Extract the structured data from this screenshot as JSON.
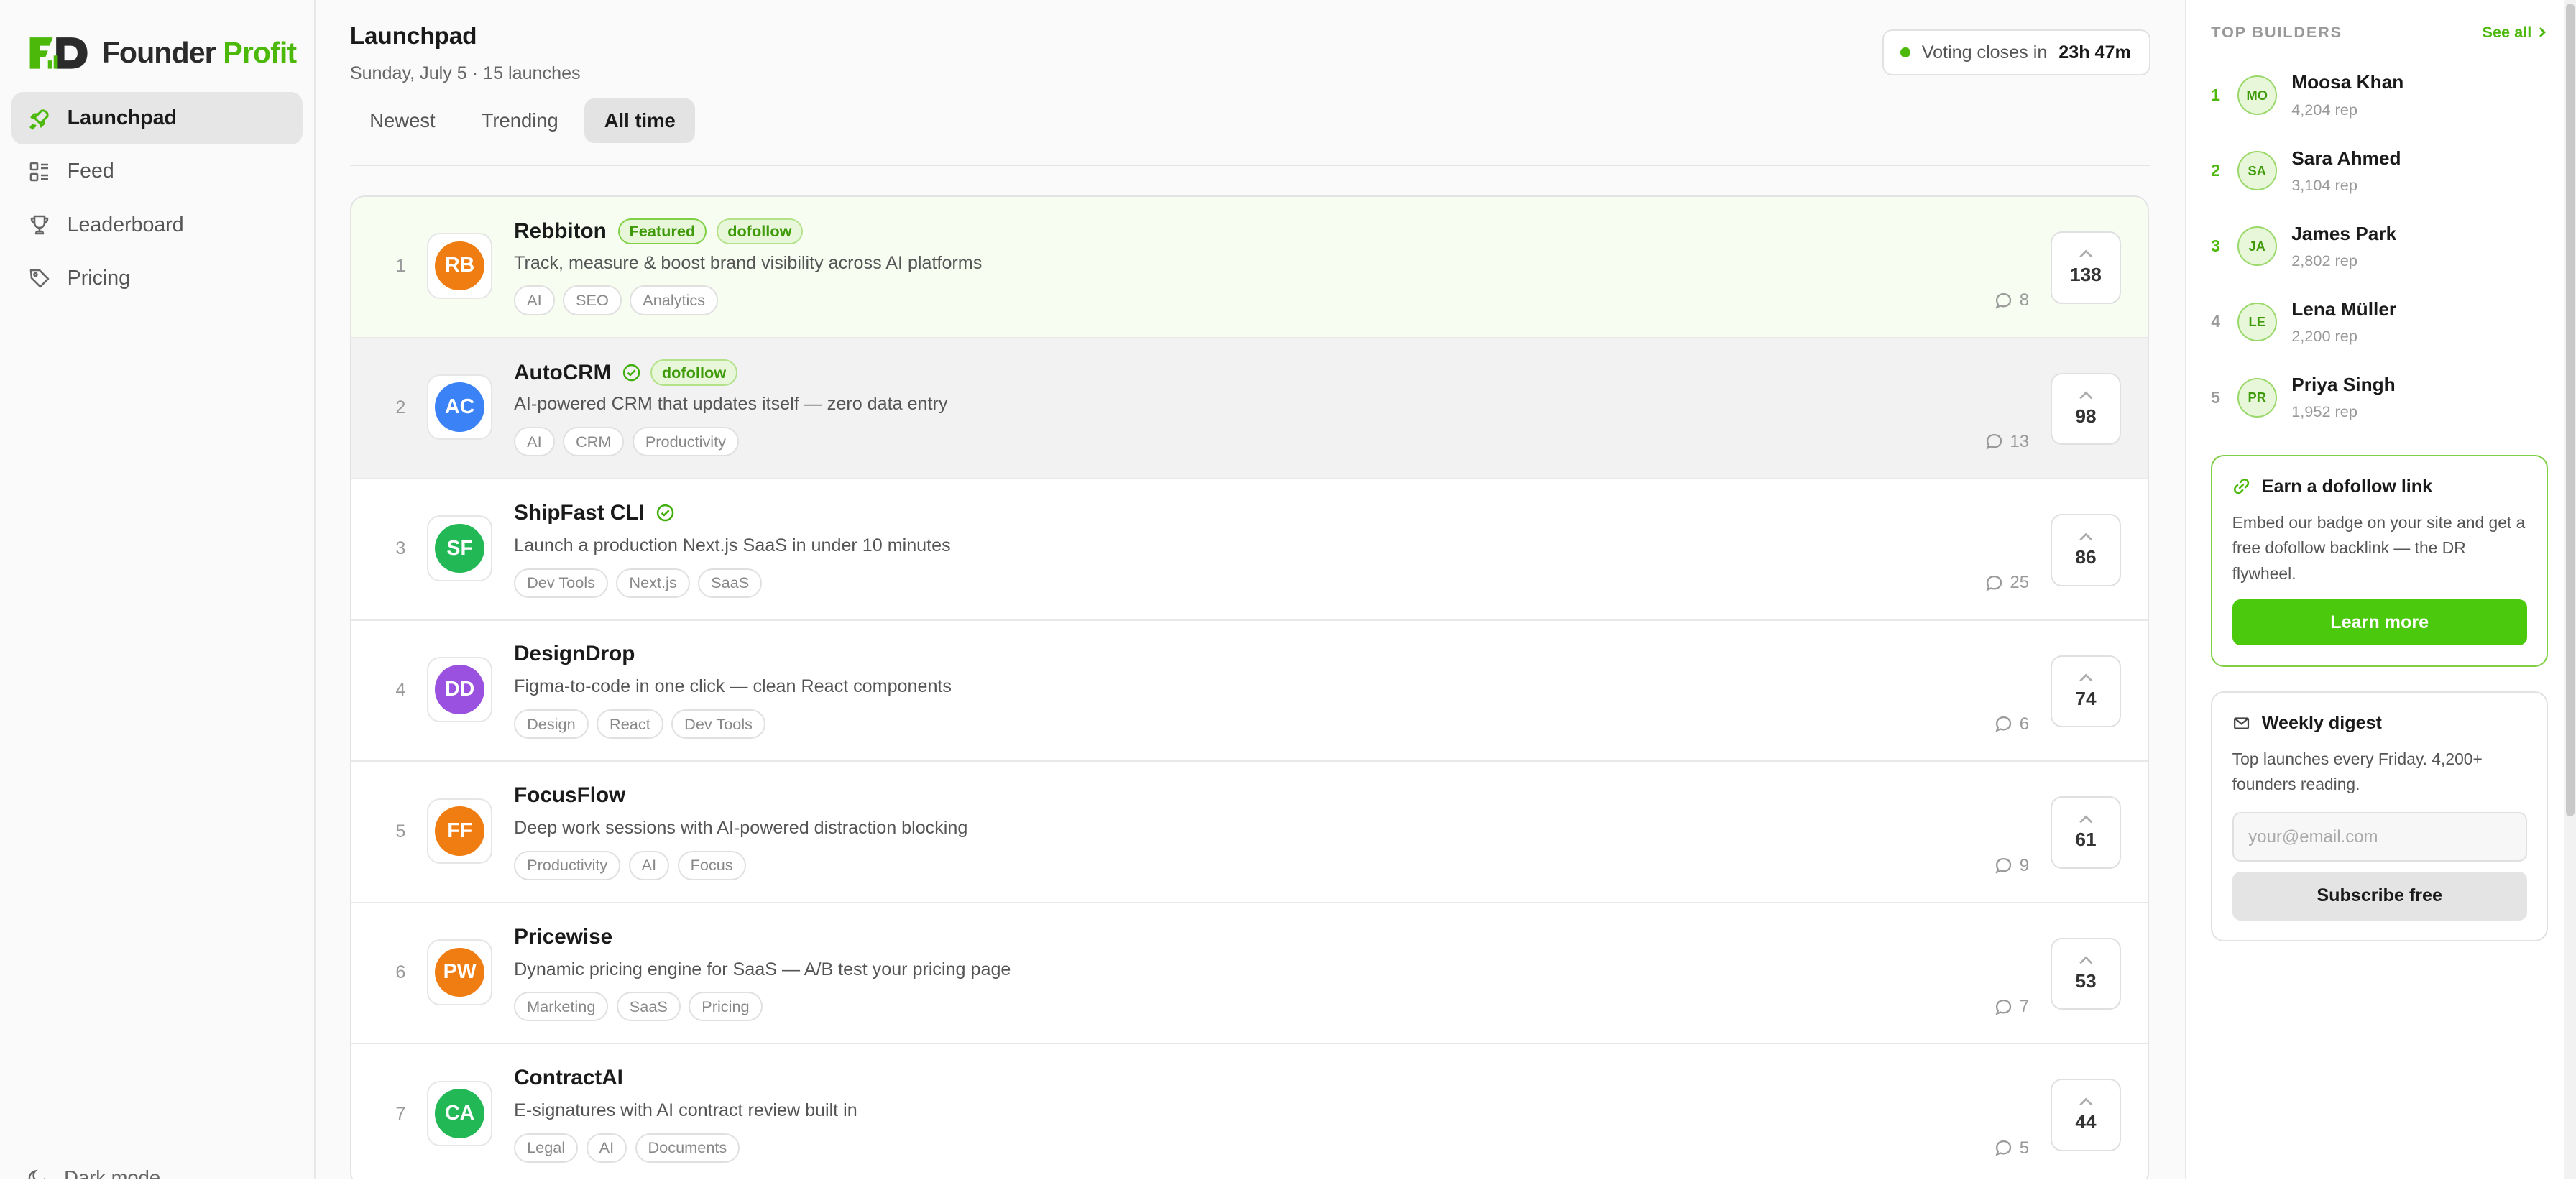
{
  "brand": {
    "name_part1": "Founder",
    "name_part2": "Profit",
    "accent": "#4bb80a"
  },
  "sidebar": {
    "items": [
      {
        "label": "Launchpad",
        "icon": "rocket-icon",
        "active": true
      },
      {
        "label": "Feed",
        "icon": "feed-icon",
        "active": false
      },
      {
        "label": "Leaderboard",
        "icon": "trophy-icon",
        "active": false
      },
      {
        "label": "Pricing",
        "icon": "tag-icon",
        "active": false
      }
    ],
    "bottom_label": "Dark mode"
  },
  "header": {
    "title": "Launchpad",
    "subtitle": "Sunday, July 5 · 15 launches",
    "voting_prefix": "Voting closes in",
    "voting_time": "23h 47m"
  },
  "tabs": [
    {
      "label": "Newest",
      "active": false
    },
    {
      "label": "Trending",
      "active": false
    },
    {
      "label": "All time",
      "active": true
    }
  ],
  "products": [
    {
      "rank": "1",
      "initials": "RB",
      "color": "#f07d12",
      "name": "Rebbiton",
      "verified": false,
      "featured_label": "Featured",
      "dofollow_label": "dofollow",
      "desc": "Track, measure & boost brand visibility across AI platforms",
      "tags": [
        "AI",
        "SEO",
        "Analytics"
      ],
      "comments": "8",
      "votes": "138",
      "state": "featured"
    },
    {
      "rank": "2",
      "initials": "AC",
      "color": "#3b82f6",
      "name": "AutoCRM",
      "verified": true,
      "featured_label": "",
      "dofollow_label": "dofollow",
      "desc": "AI-powered CRM that updates itself — zero data entry",
      "tags": [
        "AI",
        "CRM",
        "Productivity"
      ],
      "comments": "13",
      "votes": "98",
      "state": "hover"
    },
    {
      "rank": "3",
      "initials": "SF",
      "color": "#22b855",
      "name": "ShipFast CLI",
      "verified": true,
      "featured_label": "",
      "dofollow_label": "",
      "desc": "Launch a production Next.js SaaS in under 10 minutes",
      "tags": [
        "Dev Tools",
        "Next.js",
        "SaaS"
      ],
      "comments": "25",
      "votes": "86",
      "state": ""
    },
    {
      "rank": "4",
      "initials": "DD",
      "color": "#9b51e0",
      "name": "DesignDrop",
      "verified": false,
      "featured_label": "",
      "dofollow_label": "",
      "desc": "Figma-to-code in one click — clean React components",
      "tags": [
        "Design",
        "React",
        "Dev Tools"
      ],
      "comments": "6",
      "votes": "74",
      "state": ""
    },
    {
      "rank": "5",
      "initials": "FF",
      "color": "#f07d12",
      "name": "FocusFlow",
      "verified": false,
      "featured_label": "",
      "dofollow_label": "",
      "desc": "Deep work sessions with AI-powered distraction blocking",
      "tags": [
        "Productivity",
        "AI",
        "Focus"
      ],
      "comments": "9",
      "votes": "61",
      "state": ""
    },
    {
      "rank": "6",
      "initials": "PW",
      "color": "#f07d12",
      "name": "Pricewise",
      "verified": false,
      "featured_label": "",
      "dofollow_label": "",
      "desc": "Dynamic pricing engine for SaaS — A/B test your pricing page",
      "tags": [
        "Marketing",
        "SaaS",
        "Pricing"
      ],
      "comments": "7",
      "votes": "53",
      "state": ""
    },
    {
      "rank": "7",
      "initials": "CA",
      "color": "#22b855",
      "name": "ContractAI",
      "verified": false,
      "featured_label": "",
      "dofollow_label": "",
      "desc": "E-signatures with AI contract review built in",
      "tags": [
        "Legal",
        "AI",
        "Documents"
      ],
      "comments": "5",
      "votes": "44",
      "state": ""
    }
  ],
  "right": {
    "builders_title": "TOP BUILDERS",
    "see_all": "See all",
    "builders": [
      {
        "rank": "1",
        "initials": "MO",
        "name": "Moosa Khan",
        "rep": "4,204 rep",
        "top": true
      },
      {
        "rank": "2",
        "initials": "SA",
        "name": "Sara Ahmed",
        "rep": "3,104 rep",
        "top": true
      },
      {
        "rank": "3",
        "initials": "JA",
        "name": "James Park",
        "rep": "2,802 rep",
        "top": true
      },
      {
        "rank": "4",
        "initials": "LE",
        "name": "Lena Müller",
        "rep": "2,200 rep",
        "top": false
      },
      {
        "rank": "5",
        "initials": "PR",
        "name": "Priya Singh",
        "rep": "1,952 rep",
        "top": false
      }
    ],
    "dofollow_card": {
      "title": "Earn a dofollow link",
      "text": "Embed our badge on your site and get a free dofollow backlink — the DR flywheel.",
      "button": "Learn more"
    },
    "digest_card": {
      "title": "Weekly digest",
      "text": "Top launches every Friday. 4,200+ founders reading.",
      "placeholder": "your@email.com",
      "button": "Subscribe free"
    }
  }
}
